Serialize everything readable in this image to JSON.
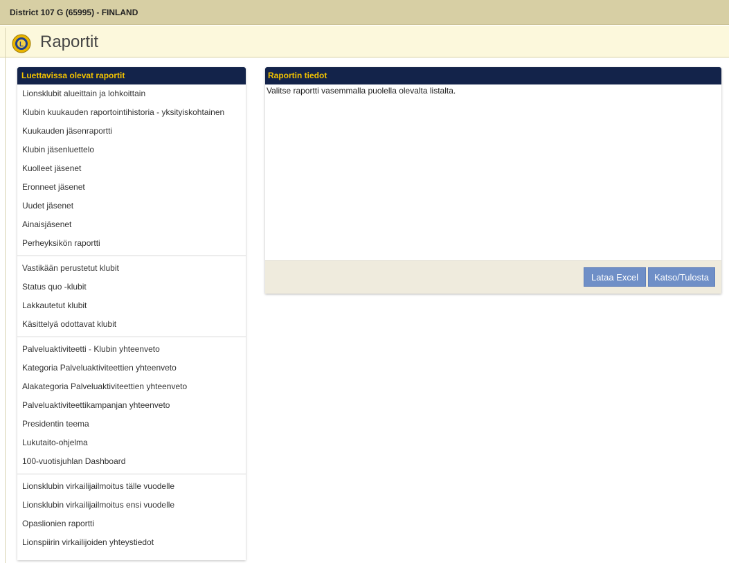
{
  "header": {
    "district": "District 107 G (65995) - FINLAND",
    "page_title": "Raportit"
  },
  "left_panel": {
    "title": "Luettavissa olevat raportit",
    "groups": [
      [
        "Lionsklubit alueittain ja lohkoittain",
        "Klubin kuukauden raportointihistoria - yksityiskohtainen",
        "Kuukauden jäsenraportti",
        "Klubin jäsenluettelo",
        "Kuolleet jäsenet",
        "Eronneet jäsenet",
        "Uudet jäsenet",
        "Ainaisjäsenet",
        "Perheyksikön raportti"
      ],
      [
        "Vastikään perustetut klubit",
        "Status quo -klubit",
        "Lakkautetut klubit",
        "Käsittelyä odottavat klubit"
      ],
      [
        "Palveluaktiviteetti - Klubin yhteenveto",
        "Kategoria Palveluaktiviteettien yhteenveto",
        "Alakategoria Palveluaktiviteettien yhteenveto",
        "Palveluaktiviteettikampanjan yhteenveto",
        "Presidentin teema",
        "Lukutaito-ohjelma",
        "100-vuotisjuhlan Dashboard"
      ],
      [
        "Lionsklubin virkailijailmoitus tälle vuodelle",
        "Lionsklubin virkailijailmoitus ensi vuodelle",
        "Opaslionien raportti",
        "Lionspiirin virkailijoiden yhteystiedot"
      ]
    ]
  },
  "right_panel": {
    "title": "Raportin tiedot",
    "message": "Valitse raportti vasemmalla puolella olevalta listalta.",
    "buttons": {
      "excel": "Lataa Excel",
      "view": "Katso/Tulosta"
    }
  },
  "colors": {
    "panel_header_bg": "#13234a",
    "panel_header_text": "#f2c200",
    "topbar_bg": "#d7cfa4",
    "titlebar_bg": "#fcf8dc",
    "button_bg": "#6f8fc7"
  },
  "icons": {
    "logo": "lions-club-logo"
  }
}
